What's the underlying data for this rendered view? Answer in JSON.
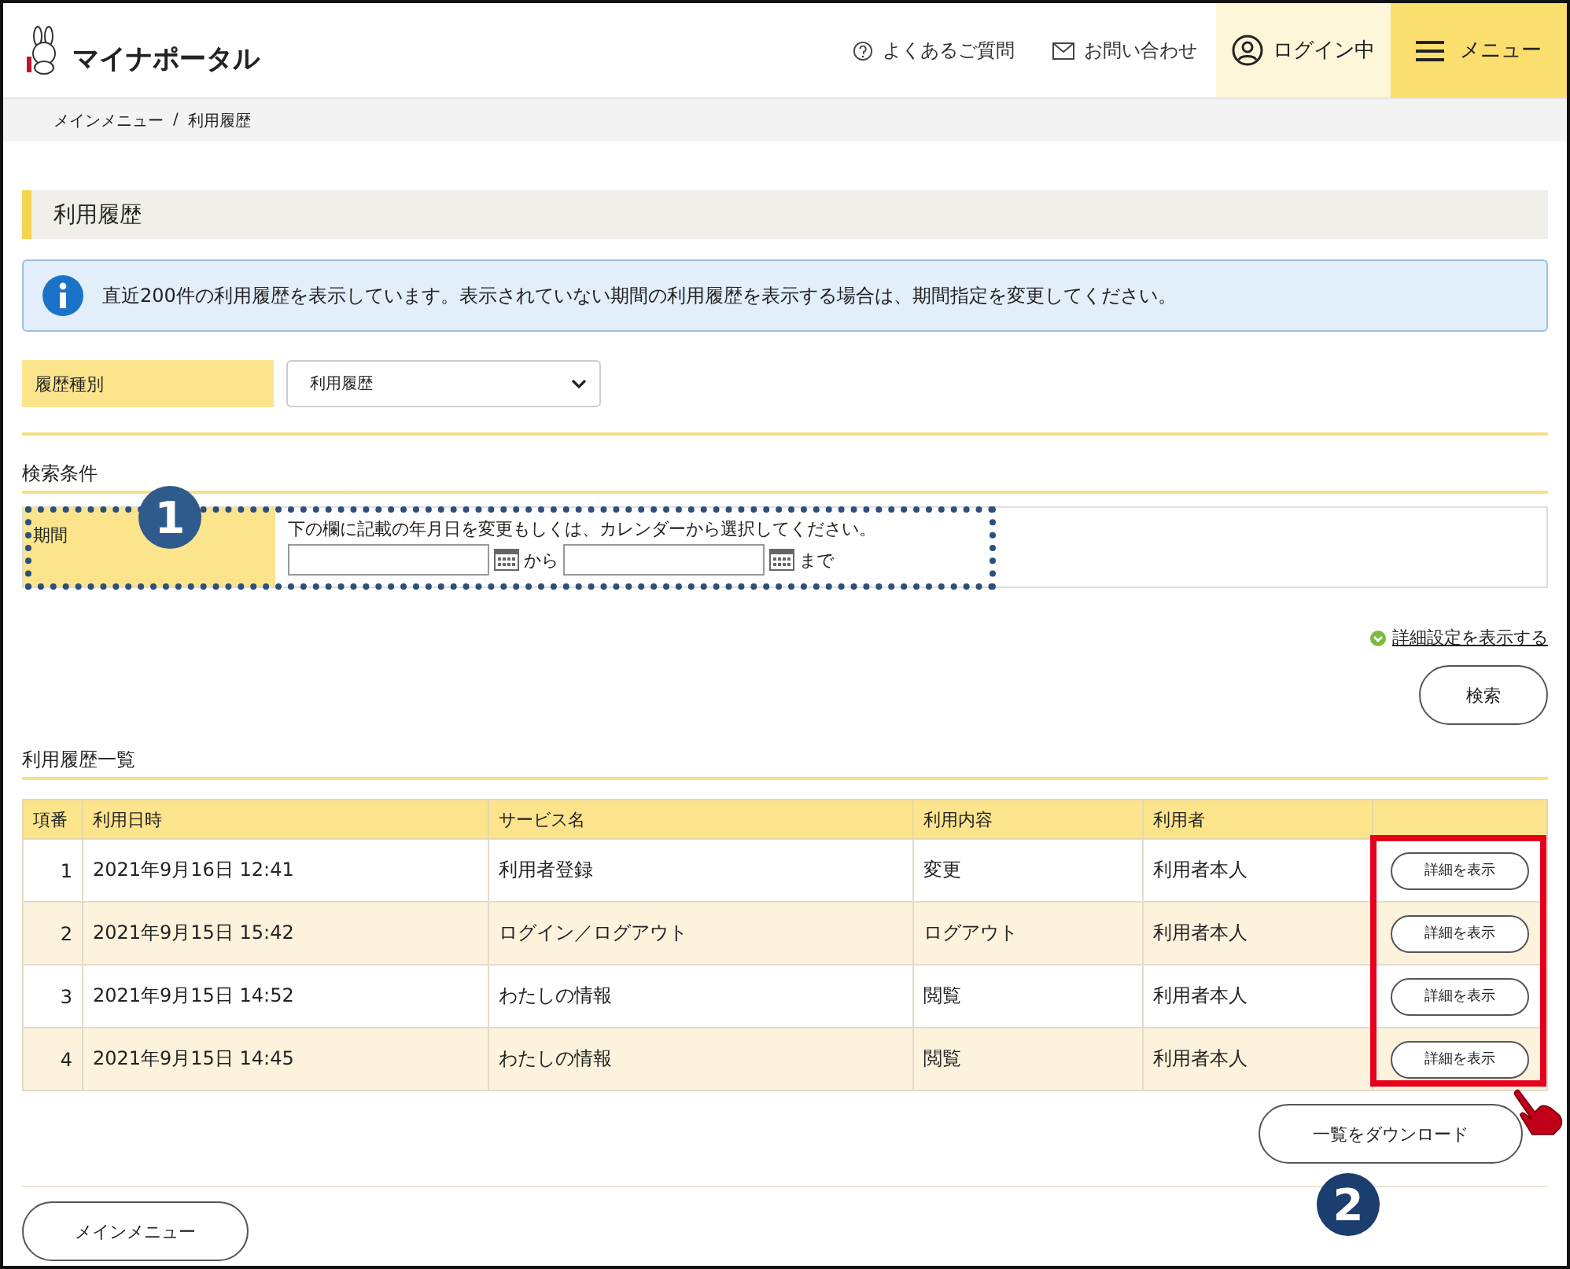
{
  "header": {
    "logo_text": "マイナポータル",
    "links": [
      {
        "kind": "help",
        "label": "よくあるご質問"
      },
      {
        "kind": "mail",
        "label": "お問い合わせ"
      }
    ],
    "login": "ログイン中",
    "menu": "メニュー"
  },
  "breadcrumb": [
    "メインメニュー",
    "/",
    "利用履歴"
  ],
  "page_title": "利用履歴",
  "info_message": "直近200件の利用履歴を表示しています。表示されていない期間の利用履歴を表示する場合は、期間指定を変更してください。",
  "history_type": {
    "label": "履歴種別",
    "value": "利用履歴"
  },
  "search_conditions": {
    "heading": "検索条件",
    "period_label": "期間",
    "instruction": "下の欄に記載の年月日を変更もしくは、カレンダーから選択してください。",
    "from_label": "から",
    "to_label": "まで"
  },
  "detail_settings_link": "詳細設定を表示する",
  "search_button": "検索",
  "list_heading": "利用履歴一覧",
  "table": {
    "columns": [
      "項番",
      "利用日時",
      "サービス名",
      "利用内容",
      "利用者"
    ],
    "rows": [
      {
        "no": "1",
        "datetime": "2021年9月16日 12:41",
        "service": "利用者登録",
        "action": "変更",
        "user": "利用者本人",
        "button": "詳細を表示"
      },
      {
        "no": "2",
        "datetime": "2021年9月15日 15:42",
        "service": "ログイン／ログアウト",
        "action": "ログアウト",
        "user": "利用者本人",
        "button": "詳細を表示"
      },
      {
        "no": "3",
        "datetime": "2021年9月15日 14:52",
        "service": "わたしの情報",
        "action": "閲覧",
        "user": "利用者本人",
        "button": "詳細を表示"
      },
      {
        "no": "4",
        "datetime": "2021年9月15日 14:45",
        "service": "わたしの情報",
        "action": "閲覧",
        "user": "利用者本人",
        "button": "詳細を表示"
      }
    ]
  },
  "download_button": "一覧をダウンロード",
  "main_menu_button": "メインメニュー",
  "annotations": [
    {
      "kind": "step",
      "text": "1",
      "color": "#2f5b8c"
    },
    {
      "kind": "step",
      "text": "2",
      "color": "#1c3e6e"
    }
  ]
}
